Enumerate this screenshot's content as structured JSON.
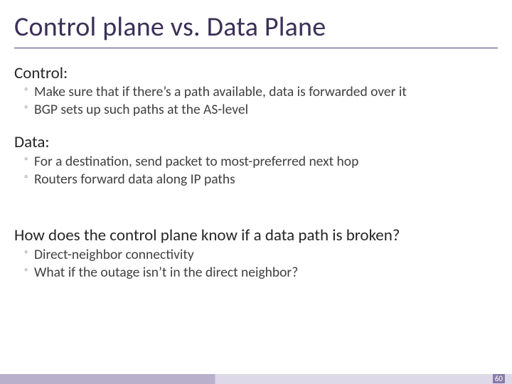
{
  "title": "Control plane vs. Data Plane",
  "sections": [
    {
      "heading": "Control:",
      "bullets": [
        "Make sure that if there’s a path available, data is forwarded over it",
        "BGP sets up such paths at the AS-level"
      ]
    },
    {
      "heading": "Data:",
      "bullets": [
        "For a destination, send packet to most-preferred next hop",
        "Routers forward data along IP paths"
      ]
    },
    {
      "heading": "How does the control plane know if a data path is broken?",
      "bullets": [
        "Direct-neighbor connectivity",
        "What if the outage isn’t in the direct neighbor?"
      ]
    }
  ],
  "page_number": "60"
}
